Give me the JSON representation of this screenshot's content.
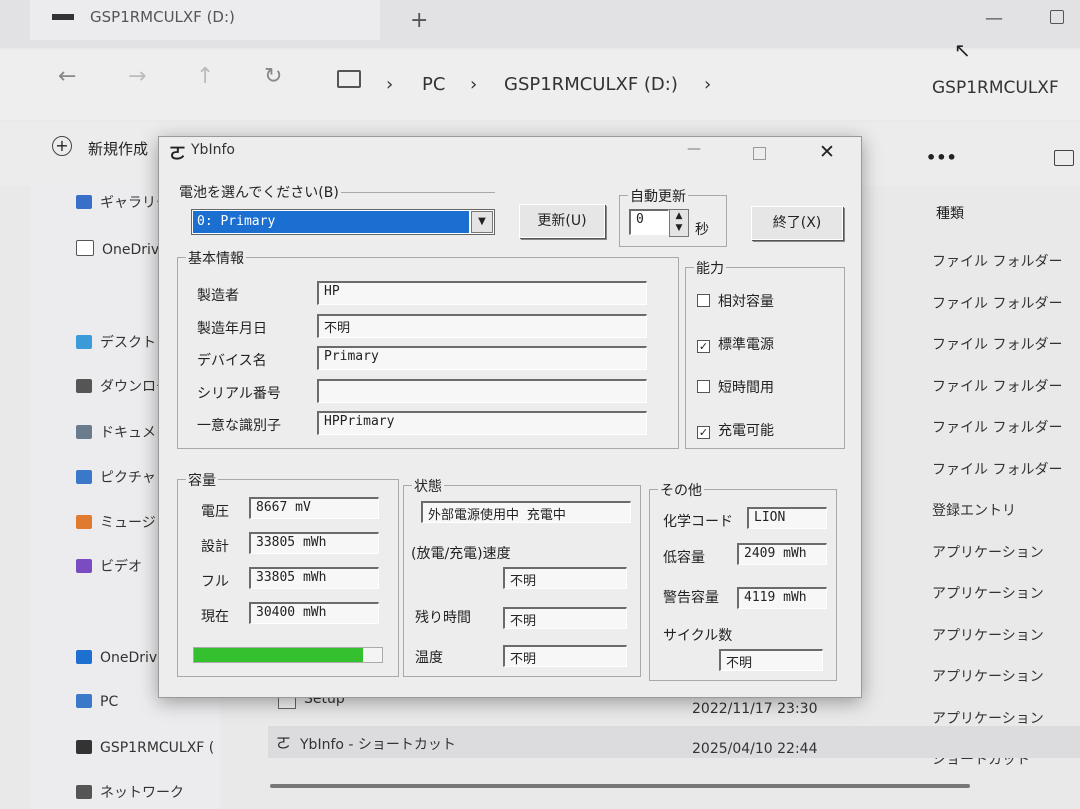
{
  "explorer": {
    "tab_title": "GSP1RMCULXF (D:)",
    "new_tab": "+",
    "breadcrumb": [
      "PC",
      "GSP1RMCULXF (D:)"
    ],
    "breadcrumb_right": "GSP1RMCULXF",
    "new_button": "新規作成",
    "more": "•••",
    "sidebar": [
      {
        "label": "ギャラリー",
        "color": "#3a6fc8"
      },
      {
        "label": "OneDrive",
        "color": "#ffffff"
      },
      {
        "label": "デスクトップ",
        "color": "#3c9ad8"
      },
      {
        "label": "ダウンロード",
        "color": "#555555"
      },
      {
        "label": "ドキュメント",
        "color": "#6a7b8e"
      },
      {
        "label": "ピクチャ",
        "color": "#3b78c8"
      },
      {
        "label": "ミュージック",
        "color": "#e07a2e"
      },
      {
        "label": "ビデオ",
        "color": "#7a4cc0"
      },
      {
        "label": "OneDrive",
        "color": "#1d6fd0"
      },
      {
        "label": "PC",
        "color": "#3a78c8"
      },
      {
        "label": "GSP1RMCULXF (",
        "color": "#333333"
      },
      {
        "label": "ネットワーク",
        "color": "#555555"
      }
    ],
    "column_type": "種類",
    "types": [
      "ファイル フォルダー",
      "ファイル フォルダー",
      "ファイル フォルダー",
      "ファイル フォルダー",
      "ファイル フォルダー",
      "ファイル フォルダー",
      "登録エントリ",
      "アプリケーション",
      "アプリケーション",
      "アプリケーション",
      "アプリケーション",
      "アプリケーション",
      "ショートカット"
    ],
    "rows": [
      {
        "name": "Setup",
        "date": "2022/11/17 23:30"
      },
      {
        "name": "YbInfo - ショートカット",
        "date": "2025/04/10 22:44"
      }
    ]
  },
  "dialog": {
    "title": "YbInfo",
    "battery_select_label": "電池を選んでください(B)",
    "battery_selected": "0: Primary",
    "refresh_button": "更新(U)",
    "auto_update_label": "自動更新",
    "auto_update_value": "0",
    "seconds_unit": "秒",
    "exit_button": "終了(X)",
    "basic": {
      "label": "基本情報",
      "rows": [
        {
          "label": "製造者",
          "value": "HP"
        },
        {
          "label": "製造年月日",
          "value": "不明"
        },
        {
          "label": "デバイス名",
          "value": "Primary"
        },
        {
          "label": "シリアル番号",
          "value": ""
        },
        {
          "label": "一意な識別子",
          "value": "HPPrimary"
        }
      ]
    },
    "capability": {
      "label": "能力",
      "items": [
        {
          "label": "相対容量",
          "checked": false
        },
        {
          "label": "標準電源",
          "checked": true
        },
        {
          "label": "短時間用",
          "checked": false
        },
        {
          "label": "充電可能",
          "checked": true
        }
      ]
    },
    "capacity": {
      "label": "容量",
      "rows": [
        {
          "label": "電圧",
          "value": "8667 mV"
        },
        {
          "label": "設計",
          "value": "33805 mWh"
        },
        {
          "label": "フル",
          "value": "33805 mWh"
        },
        {
          "label": "現在",
          "value": "30400 mWh"
        }
      ],
      "level": 0.9
    },
    "status": {
      "label": "状態",
      "state": "外部電源使用中 充電中",
      "rate_label": "(放電/充電)速度",
      "rate_value": "不明",
      "remaining_label": "残り時間",
      "remaining_value": "不明",
      "temp_label": "温度",
      "temp_value": "不明"
    },
    "other": {
      "label": "その他",
      "chem_label": "化学コード",
      "chem_value": "LION",
      "low_label": "低容量",
      "low_value": "2409 mWh",
      "warn_label": "警告容量",
      "warn_value": "4119 mWh",
      "cycle_label": "サイクル数",
      "cycle_value": "不明"
    },
    "accent": "#1a6fd0",
    "bar_color": "#35c030"
  }
}
